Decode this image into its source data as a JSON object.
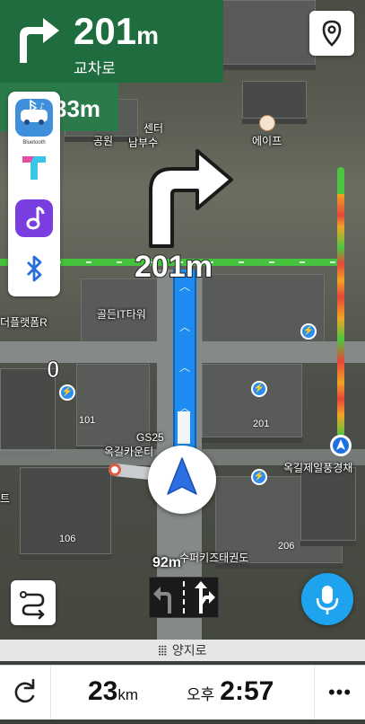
{
  "guidance": {
    "distance": "201",
    "unit": "m",
    "road_name": "교차로",
    "next_distance": "33m",
    "map_turn_distance": "201m"
  },
  "apps": [
    {
      "name": "Bluetooth Audio",
      "label": "Bluetooth"
    },
    {
      "name": "T map"
    },
    {
      "name": "Music"
    },
    {
      "name": "Bluetooth"
    }
  ],
  "map_labels": {
    "park": "공원",
    "center": "센터",
    "nambu": "남부수",
    "ep": "에이프",
    "golden": "골든IT타워",
    "plaza": "더플랫폼R",
    "zero": "0",
    "num101": "101",
    "num201": "201",
    "num106": "106",
    "num206": "206",
    "gs": "GS25",
    "gs_sub": "옥길카운티",
    "jejan": "옥길제일풍경채",
    "left_edge": "트",
    "taekwon": "수퍼키즈태권도"
  },
  "lane_guidance": {
    "next_distance": "92m"
  },
  "road_bar": {
    "name": "양지로"
  },
  "bottom": {
    "remaining_distance": "23",
    "remaining_unit": "km",
    "ampm": "오후",
    "eta": "2:57",
    "more": "•••"
  },
  "colors": {
    "banner_green": "#1f6d3e",
    "route_blue": "#1e8bf0",
    "mic_blue": "#1ea3ef"
  },
  "icons": [
    "turn-right-icon",
    "location-pin-icon",
    "route-options-icon",
    "microphone-icon",
    "refresh-icon",
    "more-icon",
    "ev-charger-icon",
    "cafe-icon",
    "car-navigation-arrow-icon"
  ]
}
